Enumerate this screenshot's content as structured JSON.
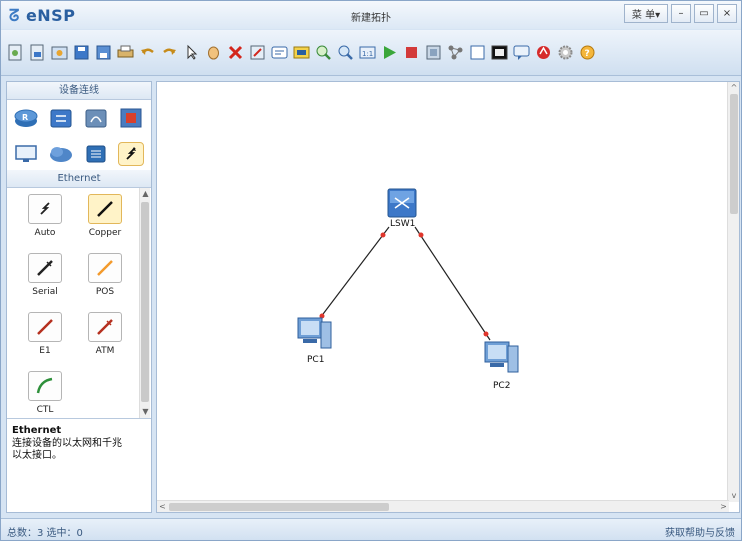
{
  "app": {
    "logo": "eNSP",
    "window_title": "新建拓扑",
    "menu_label": "菜 单▾",
    "min_label": "–",
    "max_label": "▭",
    "close_label": "×"
  },
  "toolbar": {
    "icons": [
      "new-topology",
      "new-lab",
      "open",
      "save",
      "save-as",
      "print",
      "undo",
      "redo",
      "select",
      "pan",
      "delete",
      "delete-links",
      "text",
      "palette",
      "zoom-in",
      "zoom-out",
      "fit",
      "start-all",
      "stop-all",
      "capture",
      "settings",
      "display-grid",
      "command-line",
      "chat",
      "huawei",
      "config",
      "help"
    ]
  },
  "left_panel": {
    "section_title": "设备连线",
    "device_categories": [
      {
        "name": "router"
      },
      {
        "name": "switch"
      },
      {
        "name": "wireless"
      },
      {
        "name": "firewall"
      },
      {
        "name": "pc"
      },
      {
        "name": "cloud"
      },
      {
        "name": "other"
      },
      {
        "name": "cable",
        "selected": true
      }
    ],
    "cable_section_title": "Ethernet",
    "cables": [
      {
        "label": "Auto",
        "selected": false,
        "color": "#222222"
      },
      {
        "label": "Copper",
        "selected": true,
        "color": "#111111"
      },
      {
        "label": "Serial",
        "selected": false,
        "color": "#222222"
      },
      {
        "label": "POS",
        "selected": false,
        "color": "#f39a2c"
      },
      {
        "label": "E1",
        "selected": false,
        "color": "#b5301f"
      },
      {
        "label": "ATM",
        "selected": false,
        "color": "#b5301f"
      },
      {
        "label": "CTL",
        "selected": false,
        "color": "#2d8f3a"
      }
    ],
    "description": {
      "title": "Ethernet",
      "body": "连接设备的以太网和千兆以太接口。"
    }
  },
  "topology": {
    "nodes": [
      {
        "id": "LSW1",
        "label": "LSW1",
        "type": "switch"
      },
      {
        "id": "PC1",
        "label": "PC1",
        "type": "pc"
      },
      {
        "id": "PC2",
        "label": "PC2",
        "type": "pc"
      }
    ],
    "links": [
      {
        "from": "LSW1",
        "to": "PC1"
      },
      {
        "from": "LSW1",
        "to": "PC2"
      }
    ]
  },
  "status": {
    "left": "总数：3 选中：0",
    "right": "获取帮助与反馈"
  },
  "colors": {
    "link_endpoint": "#e0362c",
    "switch_blue": "#3d78c8",
    "accent": "#2a5fa0"
  }
}
